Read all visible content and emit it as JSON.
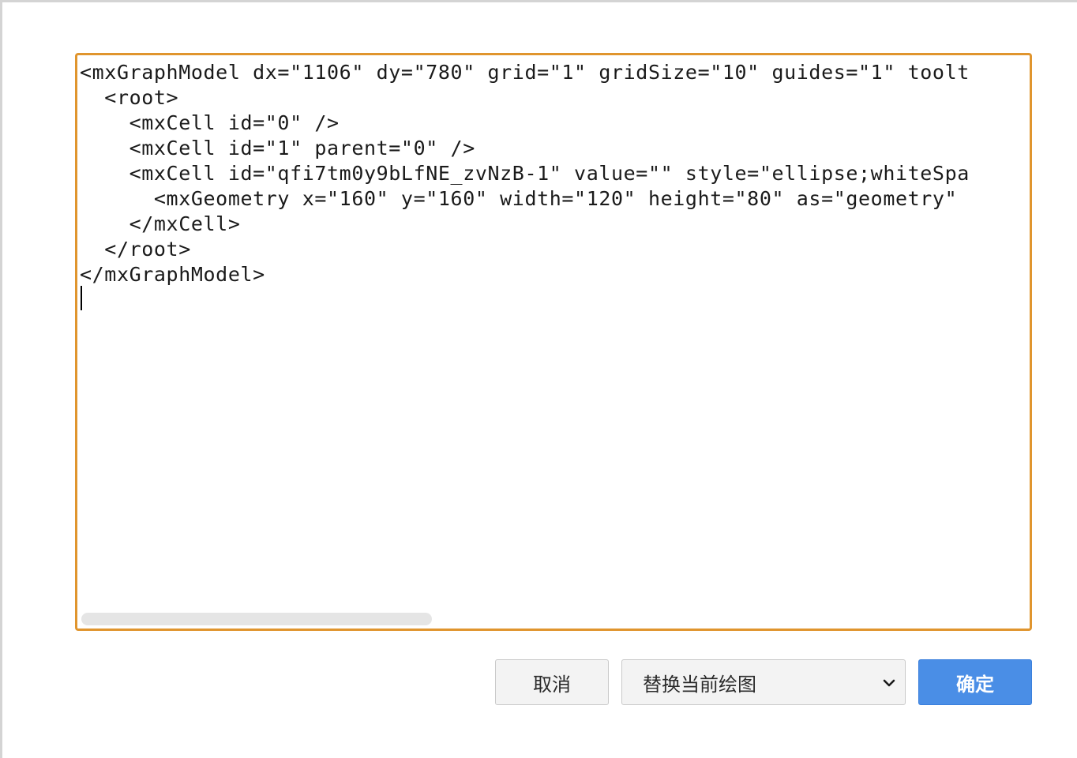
{
  "editor": {
    "lines": [
      "<mxGraphModel dx=\"1106\" dy=\"780\" grid=\"1\" gridSize=\"10\" guides=\"1\" toolt",
      "  <root>",
      "    <mxCell id=\"0\" />",
      "    <mxCell id=\"1\" parent=\"0\" />",
      "    <mxCell id=\"qfi7tm0y9bLfNE_zvNzB-1\" value=\"\" style=\"ellipse;whiteSpa",
      "      <mxGeometry x=\"160\" y=\"160\" width=\"120\" height=\"80\" as=\"geometry\"",
      "    </mxCell>",
      "  </root>",
      "</mxGraphModel>"
    ]
  },
  "actions": {
    "cancel_label": "取消",
    "mode_selected": "替换当前绘图",
    "ok_label": "确定"
  },
  "colors": {
    "editor_border": "#e0952e",
    "ok_button": "#4a8ee6"
  },
  "icons": {
    "dropdown": "chevron-down-icon"
  }
}
